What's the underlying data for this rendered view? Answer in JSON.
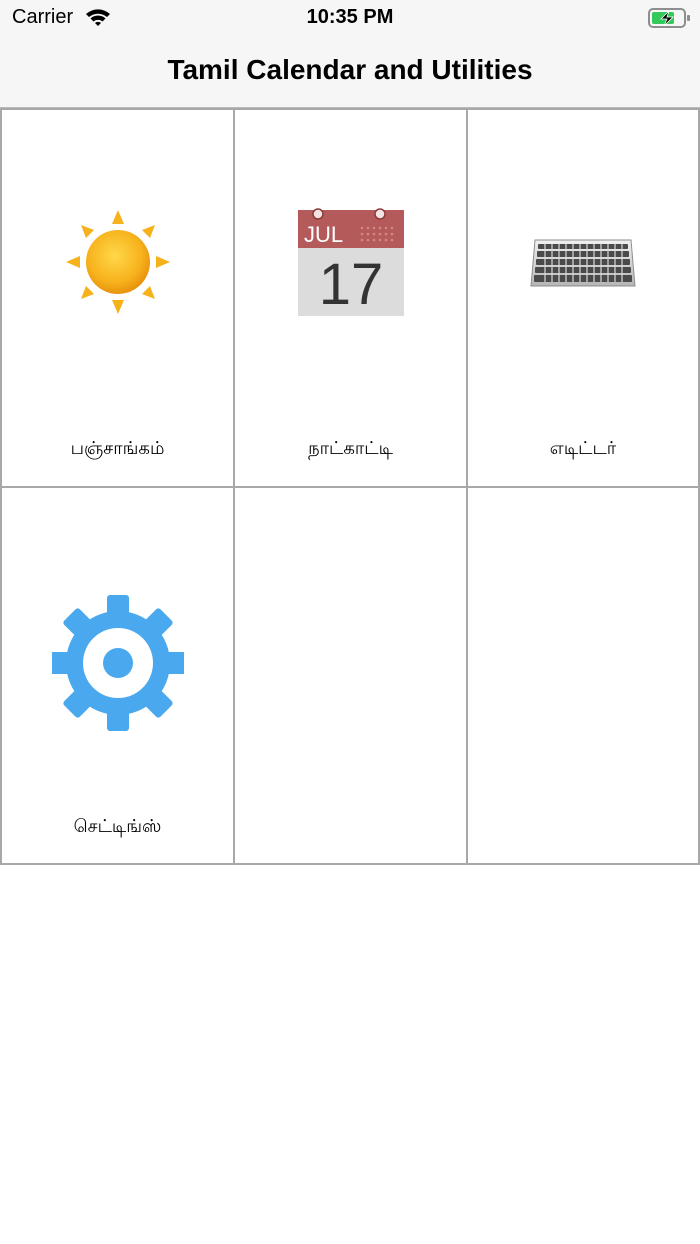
{
  "status_bar": {
    "carrier": "Carrier",
    "time": "10:35 PM"
  },
  "nav": {
    "title": "Tamil Calendar and Utilities"
  },
  "tiles": [
    {
      "label": "பஞ்சாங்கம்",
      "icon": "sun-icon"
    },
    {
      "label": "நாட்காட்டி",
      "icon": "calendar-icon",
      "calendar_month": "JUL",
      "calendar_day": "17"
    },
    {
      "label": "எடிட்டர்",
      "icon": "keyboard-icon"
    },
    {
      "label": "செட்டிங்ஸ்",
      "icon": "gear-icon"
    }
  ],
  "colors": {
    "gear": "#4aa8ee",
    "calendar_header": "#b55a5a",
    "sun": "#f5b21a",
    "battery_fill": "#34c759"
  }
}
